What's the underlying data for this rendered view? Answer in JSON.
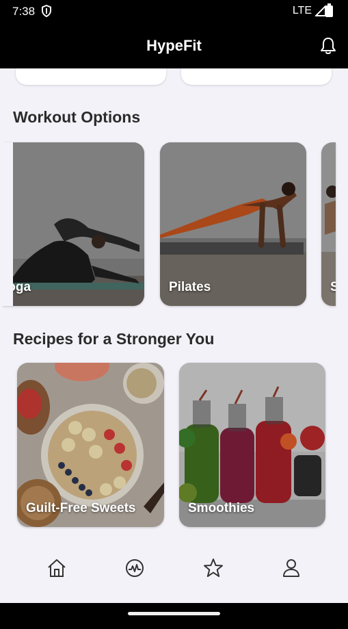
{
  "status_bar": {
    "time": "7:38",
    "network": "LTE"
  },
  "app_bar": {
    "title": "HypeFit"
  },
  "sections": {
    "workouts": {
      "title": "Workout Options",
      "items": [
        {
          "label": "Yoga"
        },
        {
          "label": "Pilates"
        },
        {
          "label": "S"
        }
      ]
    },
    "recipes": {
      "title": "Recipes for a Stronger You",
      "items": [
        {
          "label": "Guilt-Free Sweets"
        },
        {
          "label": "Smoothies"
        }
      ]
    }
  },
  "bottom_nav": {
    "items": [
      {
        "icon": "home-icon"
      },
      {
        "icon": "activity-icon"
      },
      {
        "icon": "star-icon"
      },
      {
        "icon": "profile-icon"
      }
    ]
  }
}
